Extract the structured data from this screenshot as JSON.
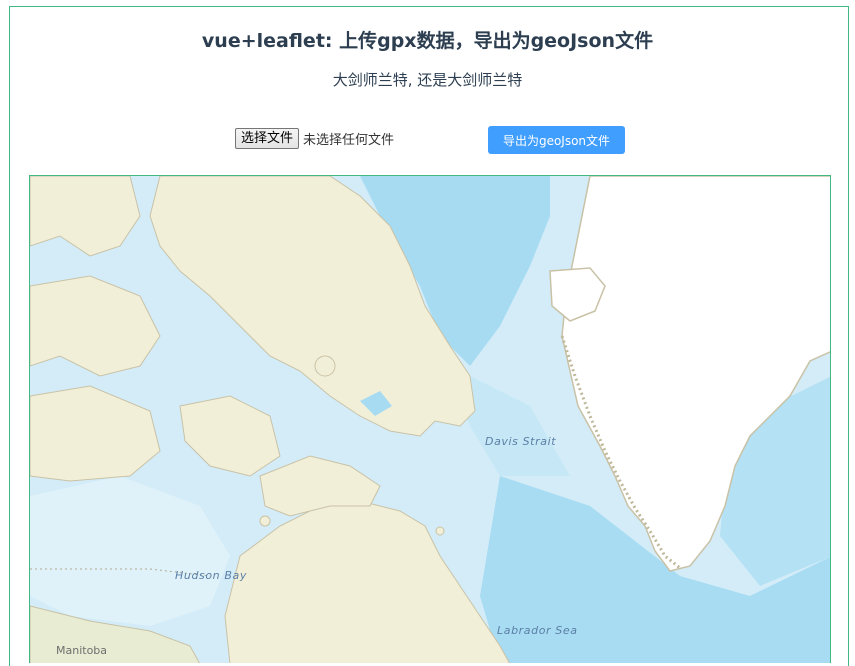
{
  "header": {
    "title": "vue+leaflet: 上传gpx数据，导出为geoJson文件",
    "subtitle": "大剑师兰特, 还是大剑师兰特"
  },
  "controls": {
    "file_button_label": "选择文件",
    "file_status": "未选择任何文件",
    "export_button_label": "导出为geoJson文件"
  },
  "map": {
    "labels": {
      "davis_strait": "Davis Strait",
      "hudson_bay": "Hudson Bay",
      "labrador_sea": "Labrador Sea",
      "manitoba": "Manitoba"
    },
    "colors": {
      "ocean_deep": "#a8dcf2",
      "ocean_shallow": "#dff2fa",
      "land": "#f2efd9",
      "ice": "#ffffff",
      "coast": "#c9c2a6",
      "frame": "#42b983",
      "button": "#409eff"
    }
  }
}
